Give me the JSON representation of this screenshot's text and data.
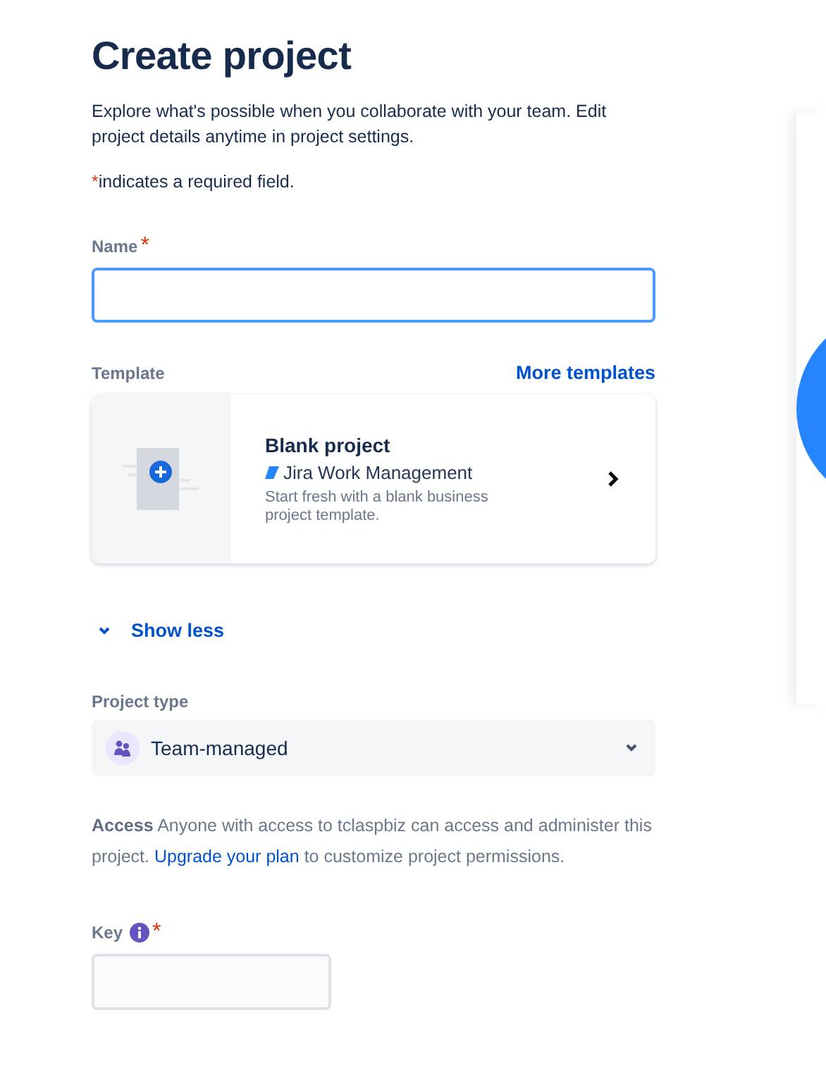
{
  "title": "Create project",
  "description": "Explore what's possible when you collaborate with your team. Edit project details anytime in project settings.",
  "required_mark": "*",
  "required_note": "indicates a required field.",
  "name_field": {
    "label": "Name",
    "required": true,
    "focused": true
  },
  "template": {
    "label": "Template",
    "link": "More templates",
    "card": {
      "title": "Blank project",
      "product": "Jira Work Management",
      "description": "Start fresh with a blank business project template."
    }
  },
  "details_toggle": {
    "label": "Show less",
    "expanded": true
  },
  "project_type": {
    "label": "Project type",
    "value": "Team-managed"
  },
  "access": {
    "text_before": "**Access** Anyone with access to tclaspbiz can access and administer this project.",
    "link": "Upgrade your plan",
    "text_after": "to customize project permissions."
  },
  "key_field": {
    "label": "Key",
    "required": true,
    "focused": false
  }
}
